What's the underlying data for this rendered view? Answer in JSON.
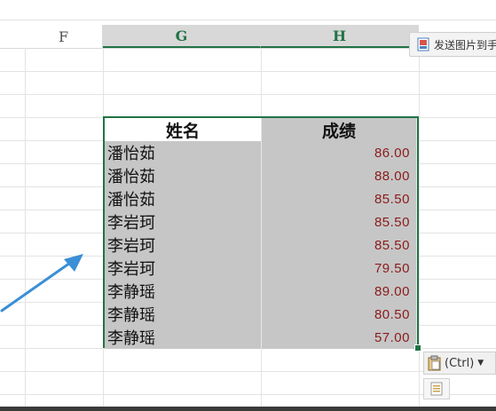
{
  "columns": {
    "f": "F",
    "g": "G",
    "h": "H"
  },
  "send_button": {
    "label": "发送图片到手"
  },
  "table": {
    "headers": {
      "name": "姓名",
      "score": "成绩"
    },
    "rows": [
      {
        "name": "潘怡茹",
        "score": "86.00"
      },
      {
        "name": "潘怡茹",
        "score": "88.00"
      },
      {
        "name": "潘怡茹",
        "score": "85.50"
      },
      {
        "name": "李岩珂",
        "score": "85.50"
      },
      {
        "name": "李岩珂",
        "score": "85.50"
      },
      {
        "name": "李岩珂",
        "score": "79.50"
      },
      {
        "name": "李静瑶",
        "score": "89.00"
      },
      {
        "name": "李静瑶",
        "score": "80.50"
      },
      {
        "name": "李静瑶",
        "score": "57.00"
      }
    ]
  },
  "paste_options": {
    "label": "(Ctrl)"
  },
  "icons": {
    "send": "send-image-icon",
    "paste": "clipboard-icon",
    "dropdown": "chevron-down-icon",
    "annotation": "arrow-annotation"
  },
  "colors": {
    "selection_border": "#217346",
    "selected_fill": "#c6c6c6",
    "score_text": "#8b1a1a",
    "annotation_arrow": "#3a8fd6"
  }
}
